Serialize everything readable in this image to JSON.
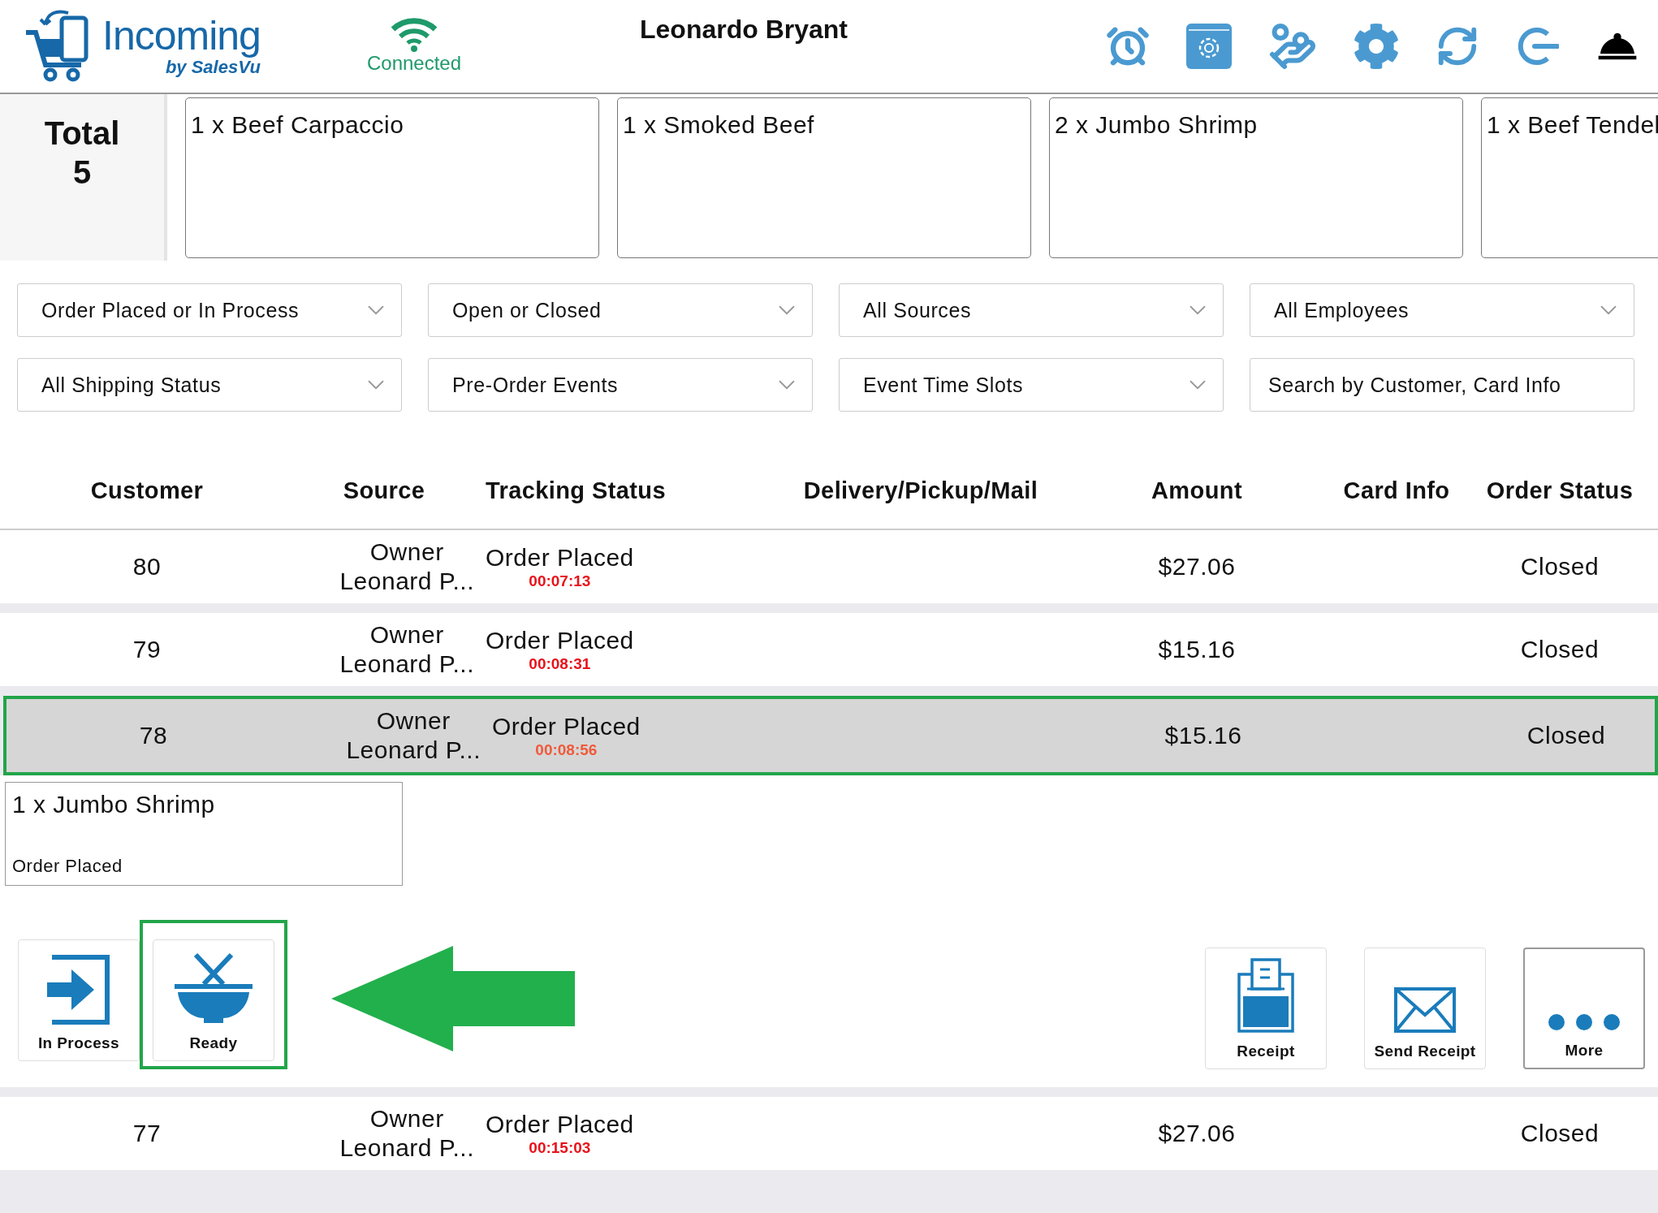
{
  "header": {
    "logo": {
      "title": "Incoming",
      "subtitle": "by SalesVu"
    },
    "connection": "Connected",
    "user": "Leonardo Bryant"
  },
  "summary": {
    "total_label": "Total",
    "total_value": "5",
    "items": [
      "1 x Beef Carpaccio",
      "1 x Smoked Beef",
      "2 x Jumbo Shrimp",
      "1 x Beef Tendel"
    ]
  },
  "filters": [
    {
      "kind": "dropdown",
      "label": "Order Placed or In Process"
    },
    {
      "kind": "dropdown",
      "label": "Open or Closed"
    },
    {
      "kind": "dropdown",
      "label": "All Sources"
    },
    {
      "kind": "dropdown",
      "label": "All Employees"
    },
    {
      "kind": "dropdown",
      "label": "All Shipping Status"
    },
    {
      "kind": "dropdown",
      "label": "Pre-Order Events"
    },
    {
      "kind": "dropdown",
      "label": "Event Time Slots"
    },
    {
      "kind": "search",
      "placeholder": "Search by Customer, Card Info"
    }
  ],
  "table": {
    "columns": [
      "Customer",
      "Source",
      "Tracking Status",
      "Delivery/Pickup/Mail",
      "Amount",
      "Card Info",
      "Order Status"
    ],
    "rows": [
      {
        "customer": "80",
        "source_type": "Owner",
        "source_name": "Leonard P...",
        "tracking": "Order Placed",
        "timer": "00:07:13",
        "amount": "$27.06",
        "status": "Closed",
        "selected": false
      },
      {
        "customer": "79",
        "source_type": "Owner",
        "source_name": "Leonard P...",
        "tracking": "Order Placed",
        "timer": "00:08:31",
        "amount": "$15.16",
        "status": "Closed",
        "selected": false
      },
      {
        "customer": "78",
        "source_type": "Owner",
        "source_name": "Leonard P...",
        "tracking": "Order Placed",
        "timer": "00:08:56",
        "amount": "$15.16",
        "status": "Closed",
        "selected": true,
        "detail": {
          "item": "1 x Jumbo Shrimp",
          "item_status": "Order Placed",
          "actions": [
            {
              "kind": "in-process",
              "label": "In Process",
              "highlighted": false,
              "focused": false
            },
            {
              "kind": "ready",
              "label": "Ready",
              "highlighted": true,
              "focused": false
            },
            {
              "kind": "receipt",
              "label": "Receipt",
              "highlighted": false,
              "focused": false
            },
            {
              "kind": "send-receipt",
              "label": "Send Receipt",
              "highlighted": false,
              "focused": false
            },
            {
              "kind": "more",
              "label": "More",
              "highlighted": false,
              "focused": true
            }
          ]
        }
      },
      {
        "customer": "77",
        "source_type": "Owner",
        "source_name": "Leonard P...",
        "tracking": "Order Placed",
        "timer": "00:15:03",
        "amount": "$27.06",
        "status": "Closed",
        "selected": false
      }
    ]
  }
}
